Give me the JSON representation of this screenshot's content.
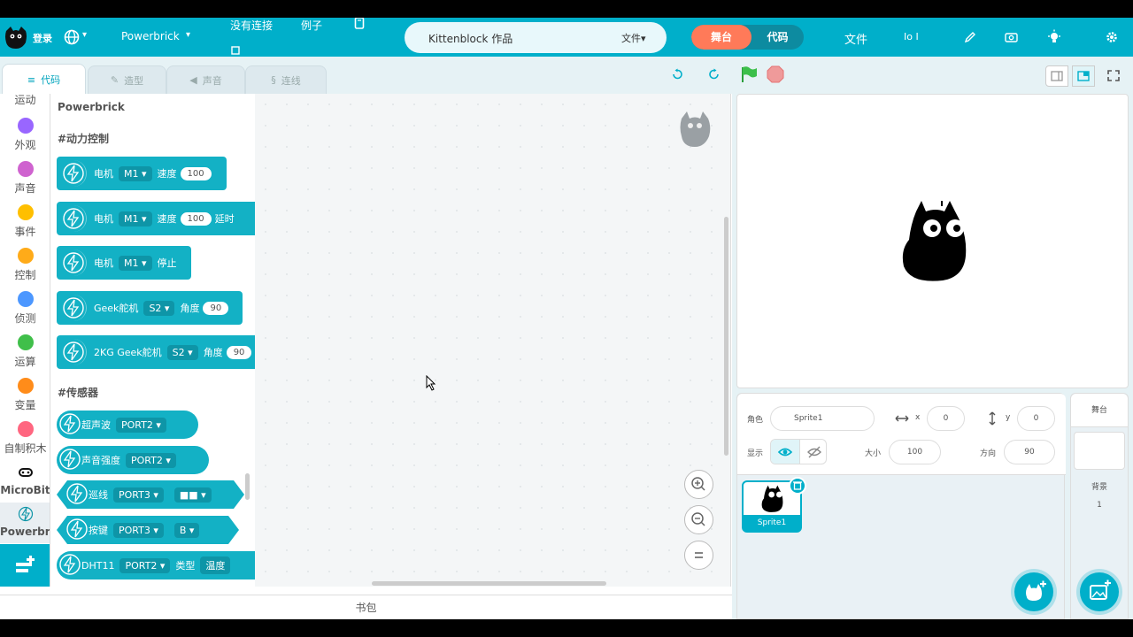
{
  "header": {
    "login": "登录",
    "device": "Powerbrick",
    "connection": "没有连接",
    "examples": "例子",
    "project_name": "Kittenblock 作品",
    "file_menu": "文件",
    "mode_stage": "舞台",
    "mode_code": "代码",
    "file_label": "文件",
    "counter": "Io I"
  },
  "tabs": [
    {
      "label": "代码"
    },
    {
      "label": "造型"
    },
    {
      "label": "声音"
    },
    {
      "label": "连线"
    }
  ],
  "categories": [
    {
      "label": "运动",
      "color": ""
    },
    {
      "label": "外观",
      "color": "#9966ff"
    },
    {
      "label": "声音",
      "color": "#cf63cf"
    },
    {
      "label": "事件",
      "color": "#ffbf00"
    },
    {
      "label": "控制",
      "color": "#ffab19"
    },
    {
      "label": "侦测",
      "color": "#4c97ff"
    },
    {
      "label": "运算",
      "color": "#40bf4a"
    },
    {
      "label": "变量",
      "color": "#ff8c1a"
    },
    {
      "label": "自制积木",
      "color": "#ff6680"
    },
    {
      "label": "MicroBit",
      "color": ""
    },
    {
      "label": "Powerbrick",
      "color": ""
    }
  ],
  "palette": {
    "title": "Powerbrick",
    "section_motor": "#动力控制",
    "section_sensor": "#传感器",
    "motor_blocks": [
      {
        "label": "电机",
        "dropdown": "M1",
        "param": "速度",
        "value": "100",
        "extra": ""
      },
      {
        "label": "电机",
        "dropdown": "M1",
        "param": "速度",
        "value": "100",
        "extra": "延时"
      },
      {
        "label": "电机",
        "dropdown": "M1",
        "param": "停止",
        "value": "",
        "extra": ""
      },
      {
        "label": "Geek舵机",
        "dropdown": "S2",
        "param": "角度",
        "value": "90",
        "extra": ""
      },
      {
        "label": "2KG Geek舵机",
        "dropdown": "S2",
        "param": "角度",
        "value": "90",
        "extra": ""
      }
    ],
    "sensor_blocks": [
      {
        "label": "超声波",
        "dropdown": "PORT2",
        "dropdown2": "",
        "extra": ""
      },
      {
        "label": "声音强度",
        "dropdown": "PORT2",
        "dropdown2": "",
        "extra": ""
      },
      {
        "label": "巡线",
        "dropdown": "PORT3",
        "dropdown2": "■■",
        "extra": ""
      },
      {
        "label": "按键",
        "dropdown": "PORT3",
        "dropdown2": "B",
        "extra": ""
      },
      {
        "label": "DHT11",
        "dropdown": "PORT2",
        "dropdown2": "",
        "extra": "类型",
        "extra2": "温度"
      }
    ]
  },
  "backpack": "书包",
  "sprite_info": {
    "role_label": "角色",
    "role_name": "Sprite1",
    "x_label": "x",
    "x_value": "0",
    "y_label": "y",
    "y_value": "0",
    "show_label": "显示",
    "size_label": "大小",
    "size_value": "100",
    "direction_label": "方向",
    "direction_value": "90"
  },
  "sprites": [
    {
      "name": "Sprite1"
    }
  ],
  "stage_panel": {
    "title": "舞台",
    "backdrop_label": "背景",
    "backdrop_count": "1"
  }
}
